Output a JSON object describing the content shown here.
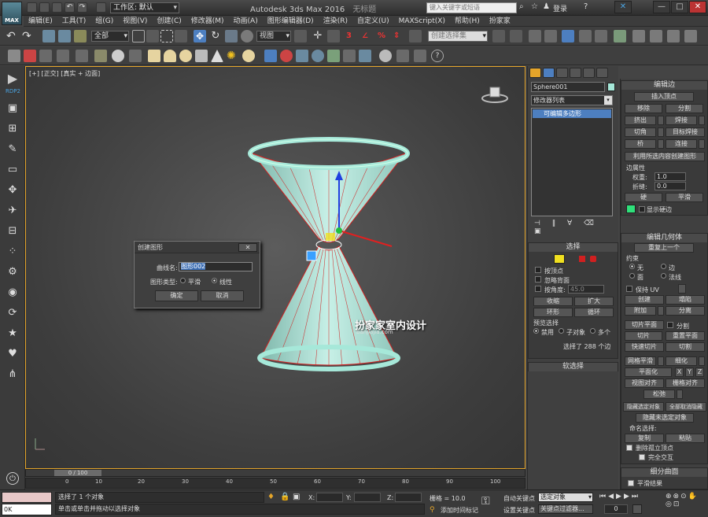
{
  "titlebar": {
    "logo": "MAX",
    "workspace_prefix": "工作区: ",
    "workspace": "默认",
    "app_title": "Autodesk 3ds Max 2016",
    "doc_title": "无标题",
    "search_placeholder": "键入关键字或短语",
    "login": "登录",
    "help": "?",
    "minimize": "—",
    "maximize": "□",
    "close": "✕"
  },
  "menubar": {
    "items": [
      "编辑(E)",
      "工具(T)",
      "组(G)",
      "视图(V)",
      "创建(C)",
      "修改器(M)",
      "动画(A)",
      "图形编辑器(D)",
      "渲染(R)",
      "自定义(U)",
      "MAXScript(X)",
      "帮助(H)",
      "扮家家"
    ]
  },
  "toolbar1": {
    "filter": "全部",
    "ref_coord": "视图",
    "named_sel": "创建选择集"
  },
  "viewport": {
    "label": "[+] [正交] [真实 + 边面]",
    "watermark": "扮家家室内设计",
    "watermark_url": "banjiajia.com"
  },
  "left_tools": {
    "rdp_label": "RDP2"
  },
  "timeline": {
    "slider": "0 / 100",
    "ticks": [
      "0",
      "10",
      "20",
      "30",
      "40",
      "50",
      "60",
      "70",
      "80",
      "90",
      "100"
    ]
  },
  "cmdpanel": {
    "object_name": "Sphere001",
    "object_color": "#a6e8d9",
    "modifier_list": "修改器列表",
    "stack_item": "可编辑多边形",
    "selection": {
      "title": "选择",
      "by_vertex": "按顶点",
      "ignore_backface": "忽略背面",
      "by_angle": "按角度:",
      "angle": "45.0",
      "shrink": "收缩",
      "grow": "扩大",
      "ring": "环形",
      "loop": "循环",
      "preview": "预览选择",
      "disabled": "禁用",
      "sub_object": "子对象",
      "multi": "多个",
      "status": "选择了 288 个边"
    },
    "soft_selection": "软选择"
  },
  "rightpanel": {
    "edit_edges": {
      "title": "编辑边",
      "insert_vertex": "插入顶点",
      "remove": "移除",
      "split": "分割",
      "extrude": "挤出",
      "weld": "焊接",
      "chamfer": "切角",
      "target_weld": "目标焊接",
      "bridge": "桥",
      "connect": "连接",
      "create_shape": "利用所选内容创建图形",
      "edge_props": "边属性",
      "weight_label": "权重:",
      "weight": "1.0",
      "crease_label": "折缝:",
      "crease": "0.0",
      "hard": "硬",
      "smooth": "平滑",
      "show_hard": "显示硬边"
    },
    "edit_geometry": {
      "title": "编辑几何体",
      "repeat_last": "重复上一个",
      "constraints": "约束",
      "none": "无",
      "edge": "边",
      "face": "面",
      "normal": "法线",
      "preserve_uv": "保持 UV",
      "create": "创建",
      "collapse": "塌陷",
      "attach": "附加",
      "detach": "分离",
      "slice_plane": "切片平面",
      "split": "分割",
      "slice": "切片",
      "reset_plane": "重置平面",
      "quick_slice": "快速切片",
      "cut": "切割",
      "msmooth": "网格平滑",
      "tessellate": "细化",
      "make_planar": "平面化",
      "x": "X",
      "y": "Y",
      "z": "Z",
      "view_align": "视图对齐",
      "grid_align": "栅格对齐",
      "relax": "松弛",
      "hide_selected": "隐藏选定对象",
      "unhide_all": "全部取消隐藏",
      "hide_unselected": "隐藏未选定对象",
      "named_sel": "命名选择:",
      "copy": "复制",
      "paste": "粘贴",
      "delete_isolated": "删除孤立顶点",
      "full_interactivity": "完全交互"
    },
    "subdivision": {
      "title": "细分曲面",
      "smooth_result": "平滑结果"
    }
  },
  "dialog": {
    "title": "创建图形",
    "curve_name_label": "曲线名:",
    "curve_name": "图形002",
    "type_label": "图形类型:",
    "smooth": "平滑",
    "linear": "线性",
    "ok": "确定",
    "cancel": "取消"
  },
  "statusbar": {
    "script_value": "0K",
    "status1": "选择了 1 个对象",
    "status2": "单击或单击并拖动以选择对象",
    "x_label": "X:",
    "y_label": "Y:",
    "z_label": "Z:",
    "grid": "栅格 = 10.0",
    "add_time_tag": "添加时间标记",
    "auto_key": "自动关键点",
    "sel_set": "选定对象",
    "set_key": "设置关键点",
    "key_filters": "关键点过滤器...",
    "frame": "0"
  },
  "colors": {
    "accent_yellow": "#e5a52a",
    "object": "#a6e8d9",
    "selection_blue": "#4d7fc0",
    "edge_red": "#d02020",
    "show_hard_green": "#2fe07a"
  }
}
